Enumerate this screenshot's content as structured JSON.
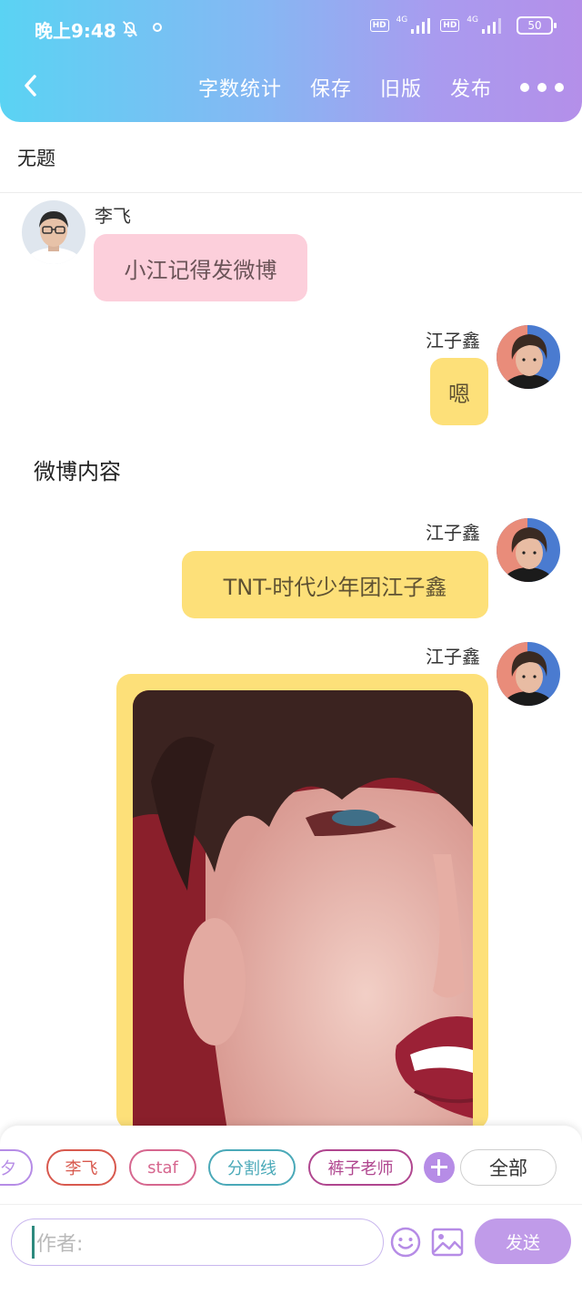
{
  "status_bar": {
    "time": "晚上9:48",
    "hd": "HD",
    "network": "4G",
    "battery": "50"
  },
  "nav": {
    "word_count": "字数统计",
    "save": "保存",
    "old_version": "旧版",
    "publish": "发布"
  },
  "document": {
    "title": "无题",
    "section_text": "微博内容"
  },
  "messages": [
    {
      "speaker": "李飞",
      "text": "小江记得发微博",
      "side": "left",
      "color": "#fccfdb"
    },
    {
      "speaker": "江子鑫",
      "text": "嗯",
      "side": "right",
      "color": "#fde079"
    },
    {
      "speaker": "江子鑫",
      "text": "TNT-时代少年团江子鑫",
      "side": "right",
      "color": "#fde079"
    },
    {
      "speaker": "江子鑫",
      "type": "image",
      "side": "right"
    }
  ],
  "tags": [
    {
      "label": "夕",
      "color": "#b68ce6"
    },
    {
      "label": "李飞",
      "color": "#d8594e"
    },
    {
      "label": "staf",
      "color": "#d6678f"
    },
    {
      "label": "分割线",
      "color": "#4aa9b8"
    },
    {
      "label": "裤子老师",
      "color": "#b0468f"
    }
  ],
  "bottom": {
    "all_label": "全部",
    "author_placeholder": "作者:",
    "send_label": "发送"
  },
  "icons": [
    "back-icon",
    "more-icon",
    "bell-icon",
    "plus-icon",
    "emoji-icon",
    "image-icon"
  ],
  "colors": {
    "accent": "#b68ce6",
    "header_start": "#5ad3f3",
    "header_end": "#b48fe9"
  }
}
